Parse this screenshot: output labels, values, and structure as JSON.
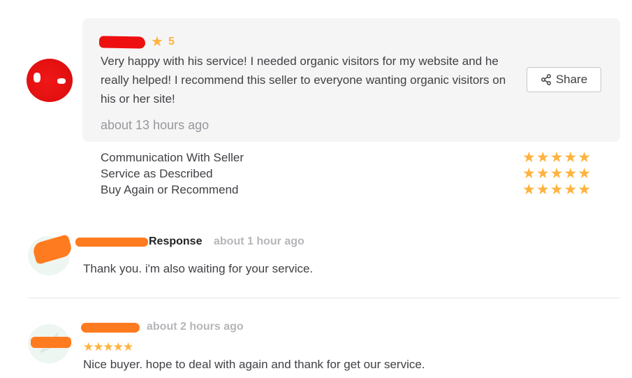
{
  "review": {
    "rating_value": "5",
    "text": "Very happy with his service! I needed organic visitors for my website and he really helped! I recommend this seller to everyone wanting organic visitors on his or her site!",
    "time": "about 13 hours ago",
    "share_label": "Share",
    "criteria": [
      {
        "label": "Communication With Seller",
        "stars": 5
      },
      {
        "label": "Service as Described",
        "stars": 5
      },
      {
        "label": "Buy Again or Recommend",
        "stars": 5
      }
    ]
  },
  "seller_response": {
    "label": "Response",
    "time": "about 1 hour ago",
    "text": "Thank you. i'm also waiting for your service."
  },
  "buyer_review": {
    "time": "about 2 hours ago",
    "stars": 5,
    "text": "Nice buyer. hope to deal with again and thank for get our service."
  },
  "colors": {
    "star": "#ffb33e",
    "card_bg": "#f5f5f5",
    "text": "#404145",
    "muted": "#95979d"
  }
}
